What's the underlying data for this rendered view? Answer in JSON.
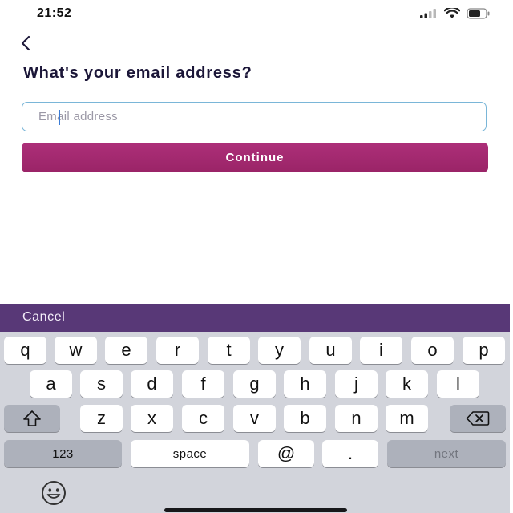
{
  "status_bar": {
    "time": "21:52",
    "icons": [
      "signal-icon",
      "wifi-icon",
      "battery-icon"
    ]
  },
  "header": {
    "back_icon": "chevron-left-icon"
  },
  "title": "What's your email address?",
  "email_field": {
    "placeholder": "Email address",
    "value": ""
  },
  "continue_label": "Continue",
  "accessory": {
    "cancel_label": "Cancel"
  },
  "keyboard": {
    "row1": [
      "q",
      "w",
      "e",
      "r",
      "t",
      "y",
      "u",
      "i",
      "o",
      "p"
    ],
    "row2": [
      "a",
      "s",
      "d",
      "f",
      "g",
      "h",
      "j",
      "k",
      "l"
    ],
    "row3": [
      "z",
      "x",
      "c",
      "v",
      "b",
      "n",
      "m"
    ],
    "row4": {
      "numbers": "123",
      "space": "space",
      "at": "@",
      "dot": ".",
      "next": "next"
    },
    "icons": [
      "shift-icon",
      "backspace-icon",
      "emoji-icon"
    ]
  },
  "colors": {
    "accent": "#A42C71",
    "accessory_bar": "#583877",
    "field_border": "#7AB6D8",
    "title": "#1B1638"
  }
}
